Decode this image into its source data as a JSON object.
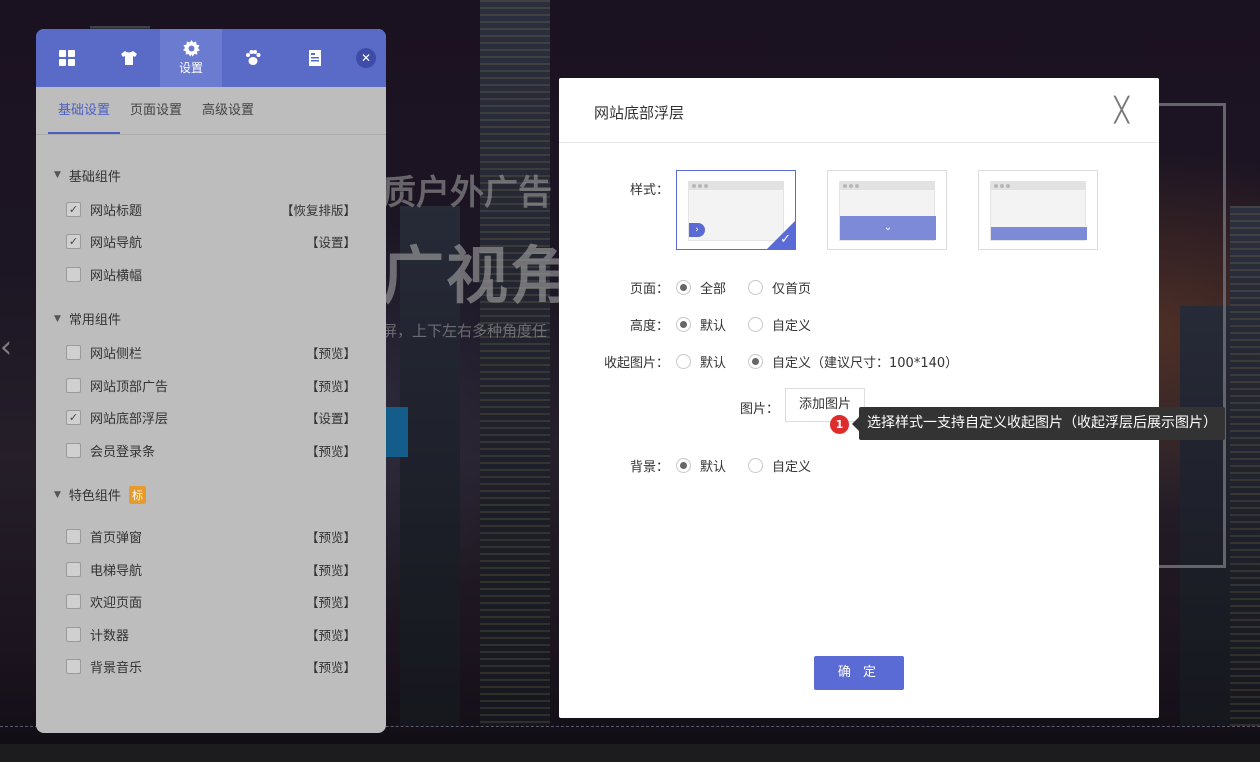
{
  "background": {
    "headline": "质户外广告",
    "headline2": "广视角",
    "subtitle": "屏，上下左右多种角度任",
    "left_arrow": "‹"
  },
  "panel": {
    "tabs": [
      {
        "icon": "grid-icon",
        "label": ""
      },
      {
        "icon": "shirt-icon",
        "label": ""
      },
      {
        "icon": "gear-icon",
        "label": "设置"
      },
      {
        "icon": "paw-icon",
        "label": ""
      },
      {
        "icon": "document-icon",
        "label": ""
      }
    ],
    "close_label": "✕",
    "subtabs": [
      "基础设置",
      "页面设置",
      "高级设置"
    ],
    "sections": [
      {
        "title": "基础组件",
        "badge": "",
        "items": [
          {
            "name": "网站标题",
            "checked": true,
            "action": "【恢复排版】"
          },
          {
            "name": "网站导航",
            "checked": true,
            "action": "【设置】"
          },
          {
            "name": "网站横幅",
            "checked": false,
            "action": ""
          }
        ]
      },
      {
        "title": "常用组件",
        "badge": "",
        "items": [
          {
            "name": "网站侧栏",
            "checked": false,
            "action": "【预览】"
          },
          {
            "name": "网站顶部广告",
            "checked": false,
            "action": "【预览】"
          },
          {
            "name": "网站底部浮层",
            "checked": true,
            "action": "【设置】"
          },
          {
            "name": "会员登录条",
            "checked": false,
            "action": "【预览】"
          }
        ]
      },
      {
        "title": "特色组件",
        "badge": "标",
        "items": [
          {
            "name": "首页弹窗",
            "checked": false,
            "action": "【预览】"
          },
          {
            "name": "电梯导航",
            "checked": false,
            "action": "【预览】"
          },
          {
            "name": "欢迎页面",
            "checked": false,
            "action": "【预览】"
          },
          {
            "name": "计数器",
            "checked": false,
            "action": "【预览】"
          },
          {
            "name": "背景音乐",
            "checked": false,
            "action": "【预览】"
          }
        ]
      }
    ]
  },
  "modal": {
    "title": "网站底部浮层",
    "close_label": "╳",
    "style_label": "样式：",
    "page_label": "页面：",
    "page_options": [
      "全部",
      "仅首页"
    ],
    "page_selected": "全部",
    "height_label": "高度：",
    "height_options": [
      "默认",
      "自定义"
    ],
    "height_selected": "默认",
    "collapse_label": "收起图片：",
    "collapse_options": [
      "默认",
      "自定义（建议尺寸：100*140）"
    ],
    "collapse_selected": "自定义（建议尺寸：100*140）",
    "image_label": "图片：",
    "add_image_button": "添加图片",
    "bg_label": "背景：",
    "bg_options": [
      "默认",
      "自定义"
    ],
    "bg_selected": "默认",
    "confirm_button": "确 定"
  },
  "tooltip": {
    "badge": "1",
    "text": "选择样式一支持自定义收起图片（收起浮层后展示图片）"
  },
  "colors": {
    "accent": "#5a6bd6",
    "panel_header": "#5a6bc7",
    "tooltip_bg": "#333333",
    "badge_red": "#e02b2b"
  }
}
